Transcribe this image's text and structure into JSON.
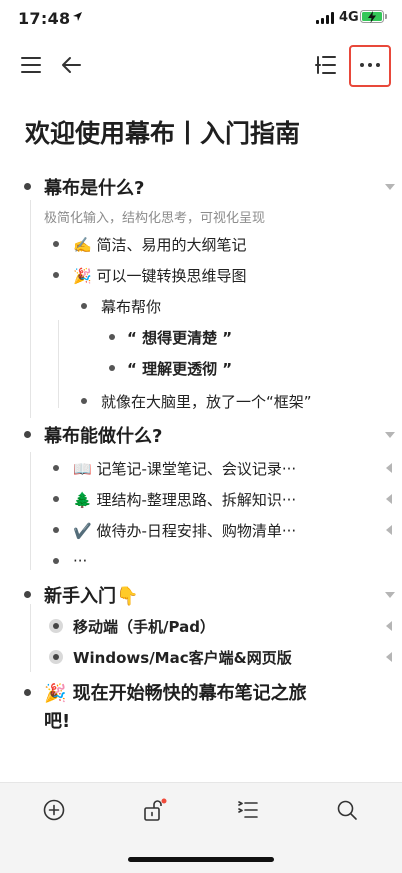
{
  "status_bar": {
    "time": "17:48",
    "network": "4G"
  },
  "toolbar": {
    "menu_icon": "hamburger-icon",
    "back_icon": "arrow-left-icon",
    "outline_icon": "outline-list-icon",
    "more_icon": "ellipsis-icon"
  },
  "document": {
    "title": "欢迎使用幕布丨入门指南",
    "items": {
      "what": {
        "text": "幕布是什么?",
        "note": "极简化输入，结构化思考，可视化呈现",
        "c1": "✍️ 简洁、易用的大纲笔记",
        "c2": "🎉 可以一键转换思维导图",
        "c3": "幕布帮你",
        "c3a": "“ 想得更清楚 ”",
        "c3b": "“ 理解更透彻 ”",
        "c4": "就像在大脑里，放了一个“框架”"
      },
      "can": {
        "text": "幕布能做什么?",
        "c1": "📖 记笔记-课堂笔记、会议记录···",
        "c2": "🌲 理结构-整理思路、拆解知识···",
        "c3": "✔️ 做待办-日程安排、购物清单···",
        "c4": "···"
      },
      "start": {
        "text": "新手入门👇",
        "c1": "移动端（手机/Pad）",
        "c2": "Windows/Mac客户端&网页版"
      },
      "go": {
        "line1": "🎉 现在开始畅快的幕布笔记之旅",
        "line2": "吧!"
      }
    }
  },
  "bottom_bar": {
    "add_icon": "add-circle-icon",
    "lock_icon": "unlock-icon",
    "format_icon": "indent-list-icon",
    "search_icon": "search-icon",
    "notification_color": "#f04b3b"
  }
}
